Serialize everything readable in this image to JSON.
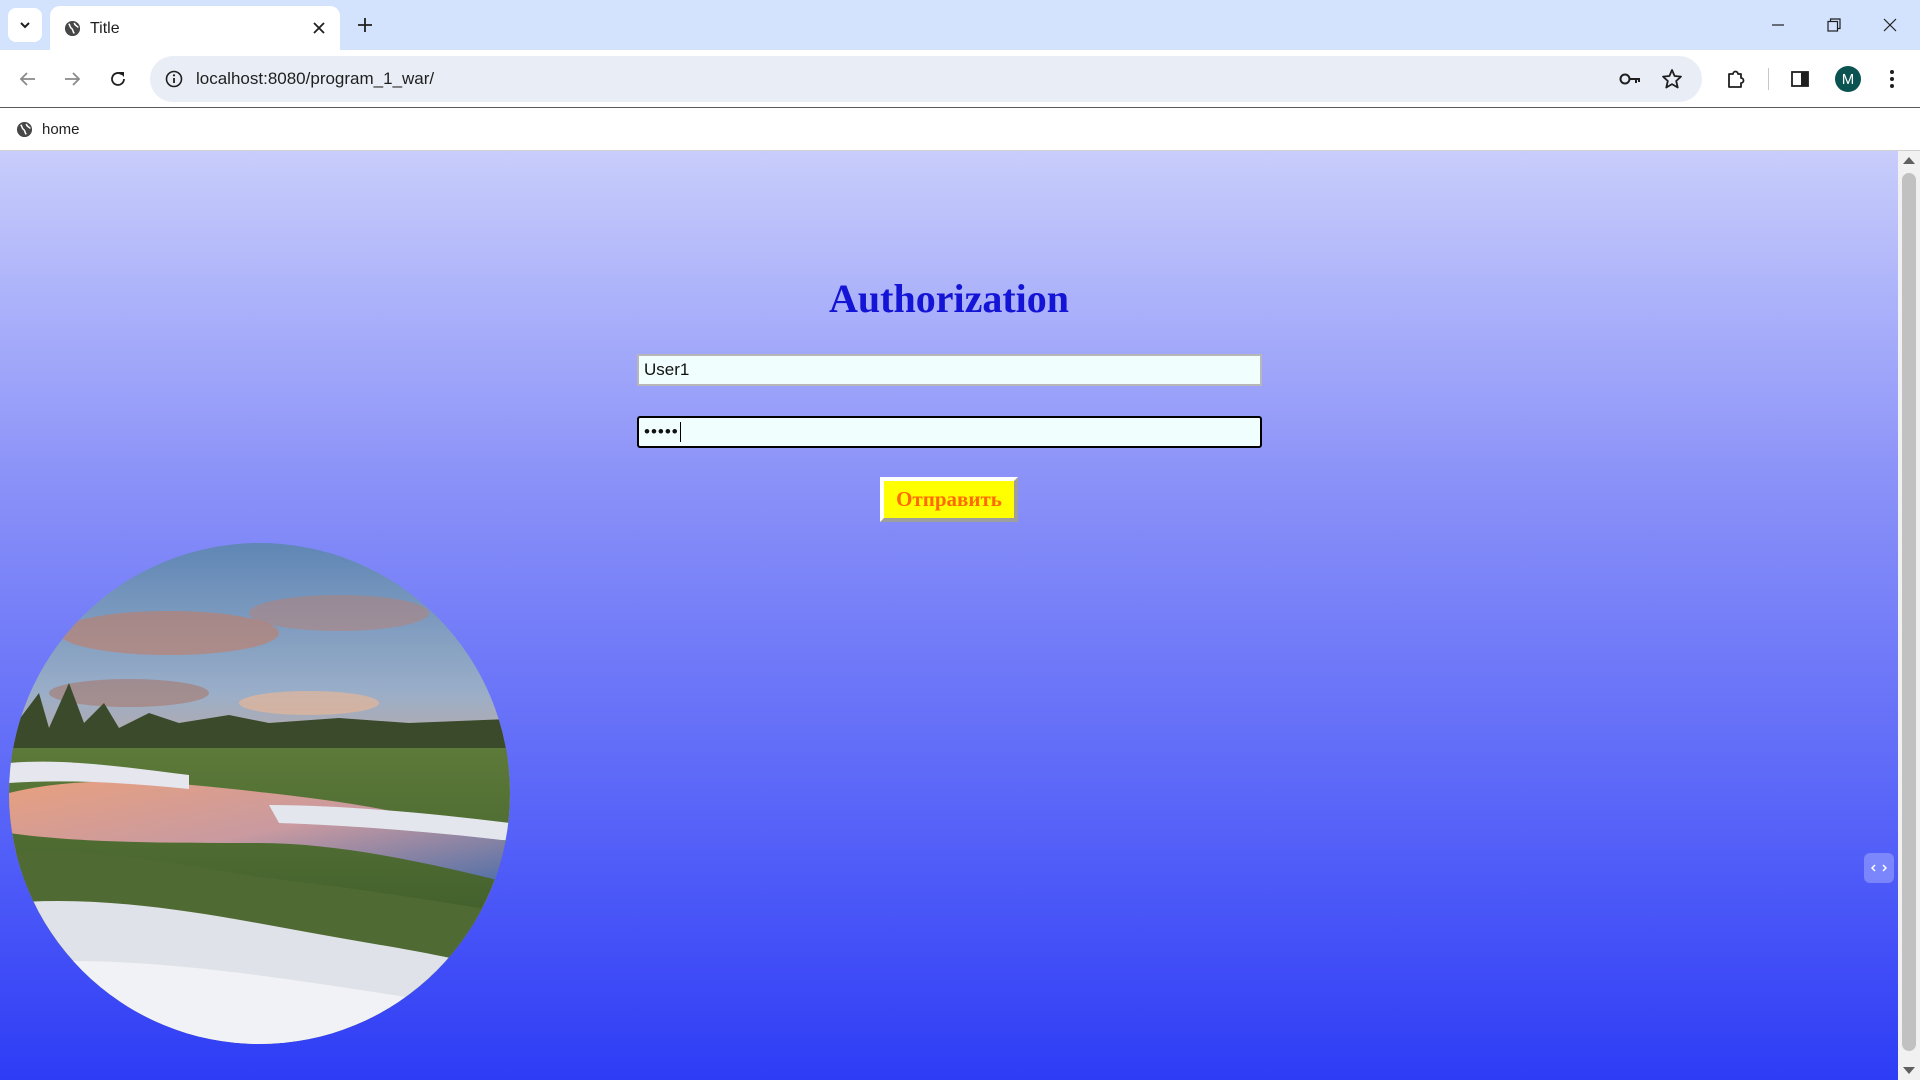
{
  "browser": {
    "tab_title": "Title",
    "url": "localhost:8080/program_1_war/",
    "profile_initial": "M",
    "bookmarks": [
      {
        "label": "home"
      }
    ],
    "colors": {
      "tabstrip": "#d3e3fd",
      "omnibox": "#e9eef6",
      "avatar": "#0b5351"
    }
  },
  "page": {
    "title": "Authorization",
    "username_value": "User1",
    "password_mask": "•••••",
    "submit_label": "Отправить",
    "colors": {
      "title": "#1414d6",
      "button_bg": "#ffff00",
      "button_text": "#ff6a00",
      "input_bg": "#f0fffd",
      "gradient_top": "#c8cdfb",
      "gradient_bottom": "#2e3cf6"
    }
  },
  "icons": [
    "tab-search-icon",
    "globe-icon",
    "close-icon",
    "plus-icon",
    "minimize-icon",
    "restore-icon",
    "back-arrow-icon",
    "forward-arrow-icon",
    "reload-icon",
    "info-icon",
    "key-icon",
    "star-icon",
    "puzzle-icon",
    "sidebar-icon",
    "kebab-menu-icon",
    "code-icon"
  ]
}
